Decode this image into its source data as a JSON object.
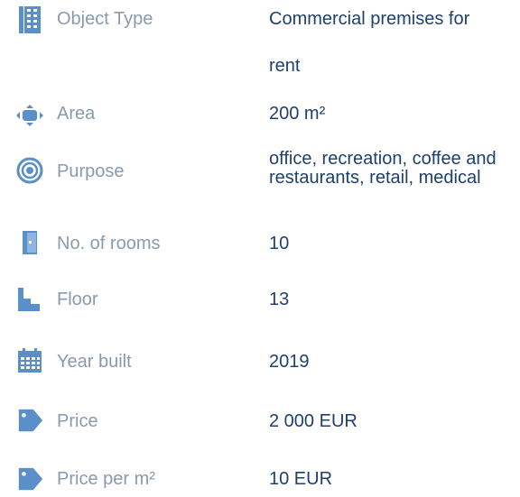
{
  "properties": [
    {
      "key": "object_type",
      "icon": "building-icon",
      "label": "Object Type",
      "value_line1": "Commercial premises for",
      "value_line2": "rent"
    },
    {
      "key": "area",
      "icon": "area-arrows-icon",
      "label": "Area",
      "value": "200 m²"
    },
    {
      "key": "purpose",
      "icon": "target-icon",
      "label": "Purpose",
      "value": "office, recreation, coffee and restaurants, retail, medical"
    },
    {
      "key": "rooms",
      "icon": "door-icon",
      "label": "No. of rooms",
      "value": "10"
    },
    {
      "key": "floor",
      "icon": "stairs-icon",
      "label": "Floor",
      "value": "13"
    },
    {
      "key": "year_built",
      "icon": "calendar-icon",
      "label": "Year built",
      "value": "2019"
    },
    {
      "key": "price",
      "icon": "price-tag-icon",
      "label": "Price",
      "value": "2 000 EUR"
    },
    {
      "key": "price_per_m2",
      "icon": "price-tag-icon",
      "label": "Price per m²",
      "value": "10 EUR"
    }
  ],
  "colors": {
    "icon": "#5b8fc9",
    "label": "#8a9aad",
    "value": "#1f3f6e"
  }
}
